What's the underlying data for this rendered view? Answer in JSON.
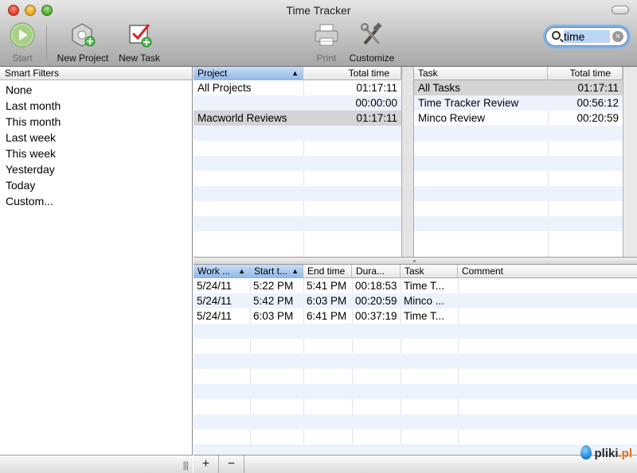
{
  "window": {
    "title": "Time Tracker"
  },
  "toolbar": {
    "start_label": "Start",
    "new_project_label": "New Project",
    "new_task_label": "New Task",
    "print_label": "Print",
    "customize_label": "Customize"
  },
  "search": {
    "value": "time"
  },
  "sidebar": {
    "header": "Smart Filters",
    "items": [
      "None",
      "Last month",
      "This month",
      "Last week",
      "This week",
      "Yesterday",
      "Today",
      "Custom..."
    ]
  },
  "projects": {
    "columns": {
      "project": "Project",
      "total": "Total time"
    },
    "rows": [
      {
        "name": "All Projects",
        "total": "01:17:11"
      },
      {
        "name": "",
        "total": "00:00:00"
      },
      {
        "name": "Macworld Reviews",
        "total": "01:17:11"
      }
    ]
  },
  "tasks": {
    "columns": {
      "task": "Task",
      "total": "Total time"
    },
    "rows": [
      {
        "name": "All Tasks",
        "total": "01:17:11"
      },
      {
        "name": "Time Tracker Review",
        "total": "00:56:12"
      },
      {
        "name": "Minco Review",
        "total": "00:20:59"
      }
    ]
  },
  "sessions": {
    "columns": {
      "work": "Work ...",
      "start": "Start t...",
      "end": "End time",
      "duration": "Dura...",
      "task": "Task",
      "comment": "Comment"
    },
    "rows": [
      {
        "work": "5/24/11",
        "start": "5:22 PM",
        "end": "5:41 PM",
        "duration": "00:18:53",
        "task": "Time T...",
        "comment": ""
      },
      {
        "work": "5/24/11",
        "start": "5:42 PM",
        "end": "6:03 PM",
        "duration": "00:20:59",
        "task": "Minco ...",
        "comment": ""
      },
      {
        "work": "5/24/11",
        "start": "6:03 PM",
        "end": "6:41 PM",
        "duration": "00:37:19",
        "task": "Time T...",
        "comment": ""
      }
    ]
  },
  "bottom_bar": {
    "add": "+",
    "remove": "−"
  },
  "watermark": {
    "name": "pliki",
    "tld": ".pl"
  },
  "colors": {
    "selection": "#d4d4d4",
    "sorted_header": "#8fb6e8",
    "stripe": "#edf3fd"
  }
}
